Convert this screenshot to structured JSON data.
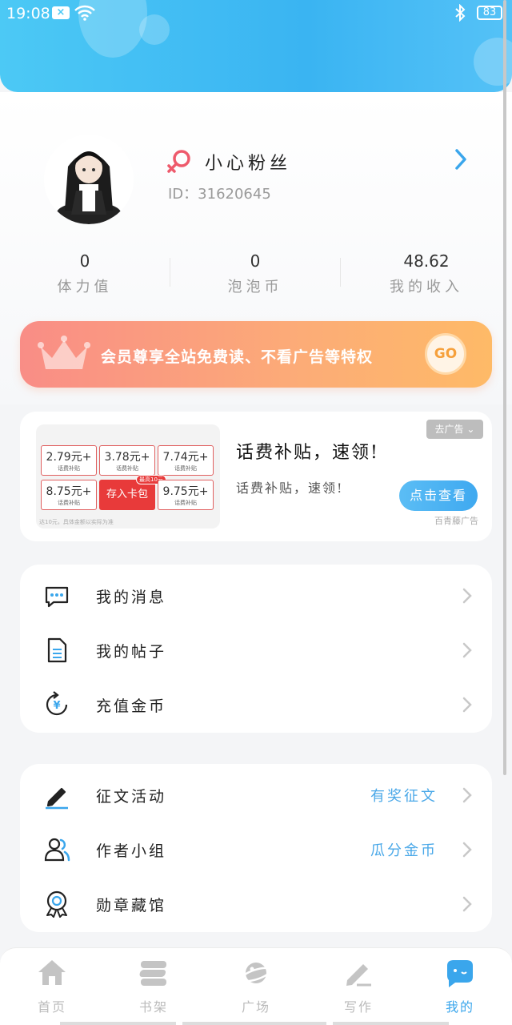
{
  "status_bar": {
    "time": "19:08",
    "battery": "83"
  },
  "profile": {
    "name": "小心粉丝",
    "id_label": "ID：31620645"
  },
  "stats": [
    {
      "value": "0",
      "label": "体力值"
    },
    {
      "value": "0",
      "label": "泡泡币"
    },
    {
      "value": "48.62",
      "label": "我的收入"
    }
  ],
  "vip_banner": {
    "text": "会员尊享全站免费读、不看广告等特权",
    "go": "GO"
  },
  "ad": {
    "close_label": "去广告",
    "title": "话费补贴，速领!",
    "subtitle": "话费补贴，速领!",
    "button": "点击查看",
    "source": "百青藤广告",
    "coupons": [
      {
        "value": "2.79",
        "unit": "元+",
        "label": "话费补贴"
      },
      {
        "value": "3.78",
        "unit": "元+",
        "label": "话费补贴"
      },
      {
        "value": "7.74",
        "unit": "元+",
        "label": "话费补贴"
      },
      {
        "value": "8.75",
        "unit": "元+",
        "label": "话费补贴"
      },
      {
        "value": "9.75",
        "unit": "元+",
        "label": "话费补贴"
      }
    ],
    "save_button": "存入卡包",
    "save_tag": "最高10元",
    "footnote": "达10元，具体金额以实际为准"
  },
  "menu_group_1": [
    {
      "label": "我的消息",
      "icon": "message-icon"
    },
    {
      "label": "我的帖子",
      "icon": "post-icon"
    },
    {
      "label": "充值金币",
      "icon": "recharge-icon"
    }
  ],
  "menu_group_2": [
    {
      "label": "征文活动",
      "extra": "有奖征文",
      "icon": "pen-icon"
    },
    {
      "label": "作者小组",
      "extra": "瓜分金币",
      "icon": "group-icon"
    },
    {
      "label": "勋章藏馆",
      "extra": "",
      "icon": "medal-icon"
    }
  ],
  "tabs": [
    {
      "label": "首页"
    },
    {
      "label": "书架"
    },
    {
      "label": "广场"
    },
    {
      "label": "写作"
    },
    {
      "label": "我的"
    }
  ],
  "colors": {
    "accent": "#3aa6ec",
    "vip_start": "#f98d86",
    "vip_end": "#feba67",
    "header": "#42bff4"
  }
}
